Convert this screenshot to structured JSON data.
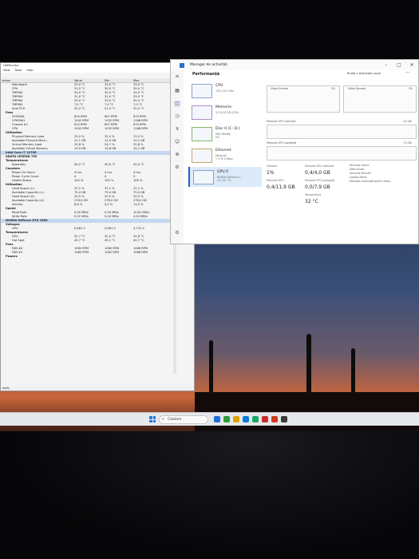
{
  "hwmonitor": {
    "title": "HWMonitor",
    "menu": [
      "View",
      "Tools",
      "Help"
    ],
    "columns": {
      "sensor": "ensor",
      "value": "Value",
      "min": "Min",
      "max": "Max"
    },
    "rows": [
      {
        "name": "Mainboard",
        "value": "33,0 °C",
        "min": "33,0 °C",
        "max": "33,0 °C"
      },
      {
        "name": "CPU",
        "value": "31,0 °C",
        "min": "30,0 °C",
        "max": "39,0 °C"
      },
      {
        "name": "TMPIN2",
        "value": "33,0 °C",
        "min": "33,0 °C",
        "max": "33,0 °C"
      },
      {
        "name": "TMPIN3",
        "value": "31,0 °C",
        "min": "31,0 °C",
        "max": "33,0 °C"
      },
      {
        "name": "TMPIN4",
        "value": "25,0 °C",
        "min": "25,0 °C",
        "max": "25,0 °C"
      },
      {
        "name": "TMPIN5",
        "value": "7,0 °C",
        "min": "7,0 °C",
        "max": "7,0 °C"
      },
      {
        "name": "Intel PCH",
        "value": "52,0 °C",
        "min": "51,0 °C",
        "max": "52,0 °C"
      },
      {
        "name": "Fans",
        "value": "",
        "min": "",
        "max": "",
        "group": true
      },
      {
        "name": "SYSFAN1",
        "value": "615 RPM",
        "min": "607 RPM",
        "max": "879 RPM"
      },
      {
        "name": "CPUFAN1",
        "value": "1042 RPM",
        "min": "1032 RPM",
        "max": "1166 RPM"
      },
      {
        "name": "Chassis #1",
        "value": "615 RPM",
        "min": "607 RPM",
        "max": "879 RPM"
      },
      {
        "name": "CPU",
        "value": "1042 RPM",
        "min": "1032 RPM",
        "max": "1166 RPM"
      },
      {
        "name": "Utilization",
        "value": "",
        "min": "",
        "max": "",
        "group": true
      },
      {
        "name": "Physical Memory Load",
        "value": "23,0 %",
        "min": "22,0 %",
        "max": "23,0 %"
      },
      {
        "name": "Available Physical Mem...",
        "value": "12,1 GB",
        "min": "12,0 GB",
        "max": "12,2 GB"
      },
      {
        "name": "Virtual Memory Load",
        "value": "25,8 %",
        "min": "24,7 %",
        "max": "25,8 %"
      },
      {
        "name": "Available Virtual Memory",
        "value": "13,9 GB",
        "min": "13,8 GB",
        "max": "14,1 GB"
      },
      {
        "name": "Intel Core i7 12700",
        "value": "",
        "min": "",
        "max": "",
        "group": true,
        "sel": true
      },
      {
        "name": "ADATA LEGEND 750",
        "value": "",
        "min": "",
        "max": "",
        "group": true
      },
      {
        "name": "Temperatures",
        "value": "",
        "min": "",
        "max": "",
        "group": true
      },
      {
        "name": "Assembly",
        "value": "40,0 °C",
        "min": "40,0 °C",
        "max": "42,0 °C"
      },
      {
        "name": "Counters",
        "value": "",
        "min": "",
        "max": "",
        "group": true
      },
      {
        "name": "Power-On Hours",
        "value": "4 hrs",
        "min": "4 hrs",
        "max": "4 hrs"
      },
      {
        "name": "Power Cycle Count",
        "value": "4",
        "min": "4",
        "max": "4"
      },
      {
        "name": "Health Status",
        "value": "100 %",
        "min": "100 %",
        "max": "100 %"
      },
      {
        "name": "Utilization",
        "value": "",
        "min": "",
        "max": "",
        "group": true
      },
      {
        "name": "Used Space (c:)",
        "value": "37,1 %",
        "min": "37,1 %",
        "max": "37,1 %"
      },
      {
        "name": "Available Capacity (c:)",
        "value": "79,4 GB",
        "min": "79,4 GB",
        "max": "79,4 GB"
      },
      {
        "name": "Used Space (d:)",
        "value": "20,5 %",
        "min": "20,5 %",
        "max": "20,5 %"
      },
      {
        "name": "Available Capacity (d:)",
        "value": "278,0 GB",
        "min": "278,0 GB",
        "max": "278,0 GB"
      },
      {
        "name": "Activity",
        "value": "8,6 %",
        "min": "0,0 %",
        "max": "13,5 %"
      },
      {
        "name": "Speed",
        "value": "",
        "min": "",
        "max": "",
        "group": true
      },
      {
        "name": "Read Rate",
        "value": "0,00 MB/s",
        "min": "0,00 MB/s",
        "max": "10,81 MB/s"
      },
      {
        "name": "Write Rate",
        "value": "0,02 MB/s",
        "min": "0,00 MB/s",
        "max": "4,54 MB/s"
      },
      {
        "name": "NVIDIA GeForce GTX 1650",
        "value": "",
        "min": "",
        "max": "",
        "group": true,
        "sel": true
      },
      {
        "name": "Voltages",
        "value": "",
        "min": "",
        "max": "",
        "group": true
      },
      {
        "name": "GPU",
        "value": "0,661 V",
        "min": "0,661 V",
        "max": "0,731 V"
      },
      {
        "name": "Temperatures",
        "value": "",
        "min": "",
        "max": "",
        "group": true
      },
      {
        "name": "GPU",
        "value": "32,7 °C",
        "min": "32,0 °C",
        "max": "32,6 °C"
      },
      {
        "name": "Hot Spot",
        "value": "45,7 °C",
        "min": "45,1 °C",
        "max": "45,7 °C"
      },
      {
        "name": "Fans",
        "value": "",
        "min": "",
        "max": "",
        "group": true
      },
      {
        "name": "FAN #0",
        "value": "1062 RPM",
        "min": "1060 RPM",
        "max": "1066 RPM"
      },
      {
        "name": "FAN #1",
        "value": "1085 RPM",
        "min": "1082 RPM",
        "max": "1088 RPM"
      },
      {
        "name": "Powers",
        "value": "",
        "min": "",
        "max": "",
        "group": true
      }
    ],
    "status": "eady"
  },
  "taskmanager": {
    "title": "Manager de activități",
    "section": "Performanță",
    "run_task": "Rulați o activitate nouă",
    "items": [
      {
        "title": "CPU",
        "sub": "12% 3,91 GHz"
      },
      {
        "title": "Memorie",
        "sub": "3,7/15,8 GB (23%)"
      },
      {
        "title": "Disc 0 (C: D:)",
        "sub": "SSD (NVMe)\n0%"
      },
      {
        "title": "Ethernet",
        "sub": "Ethernet\nT: 0 R: 0 Kbps"
      },
      {
        "title": "GPU 0",
        "sub": "NVIDIA GeForce G...\n1% (32 °C)"
      }
    ],
    "graph_labels": {
      "video_encode": "Video Encode",
      "video_encode_pct": "0%",
      "video_decode": "Video Decode",
      "video_decode_pct": "0%",
      "dedicated": "Memorie GPU dedicată",
      "dedicated_max": "4,0 GB",
      "shared": "Memorie GPU partajată",
      "shared_max": "7,9 GB"
    },
    "stats": {
      "utilization_label": "Utilizare",
      "utilization": "1%",
      "dedicated_label": "Memorie GPU dedicată",
      "dedicated": "0,4/4,0 GB",
      "gpu_mem_label": "Memorie GPU",
      "gpu_mem": "0,4/11,9 GB",
      "shared_label": "Memorie GPU partajată",
      "shared": "0,0/7,9 GB",
      "temp_label": "Temperatură",
      "temp": "32 °C"
    },
    "side_labels": [
      "Versiune driver:",
      "Dată driver:",
      "Versiune DirectX:",
      "Locație fizică:",
      "Memorie rezervată pentru hard..."
    ]
  },
  "taskbar": {
    "search": "Căutare",
    "icon_colors": [
      "#1f6fd6",
      "#2b9a3e",
      "#e0a100",
      "#0a7bd6",
      "#1da56a",
      "#c72c2c",
      "#d03a1a",
      "#3a3a3a"
    ]
  }
}
